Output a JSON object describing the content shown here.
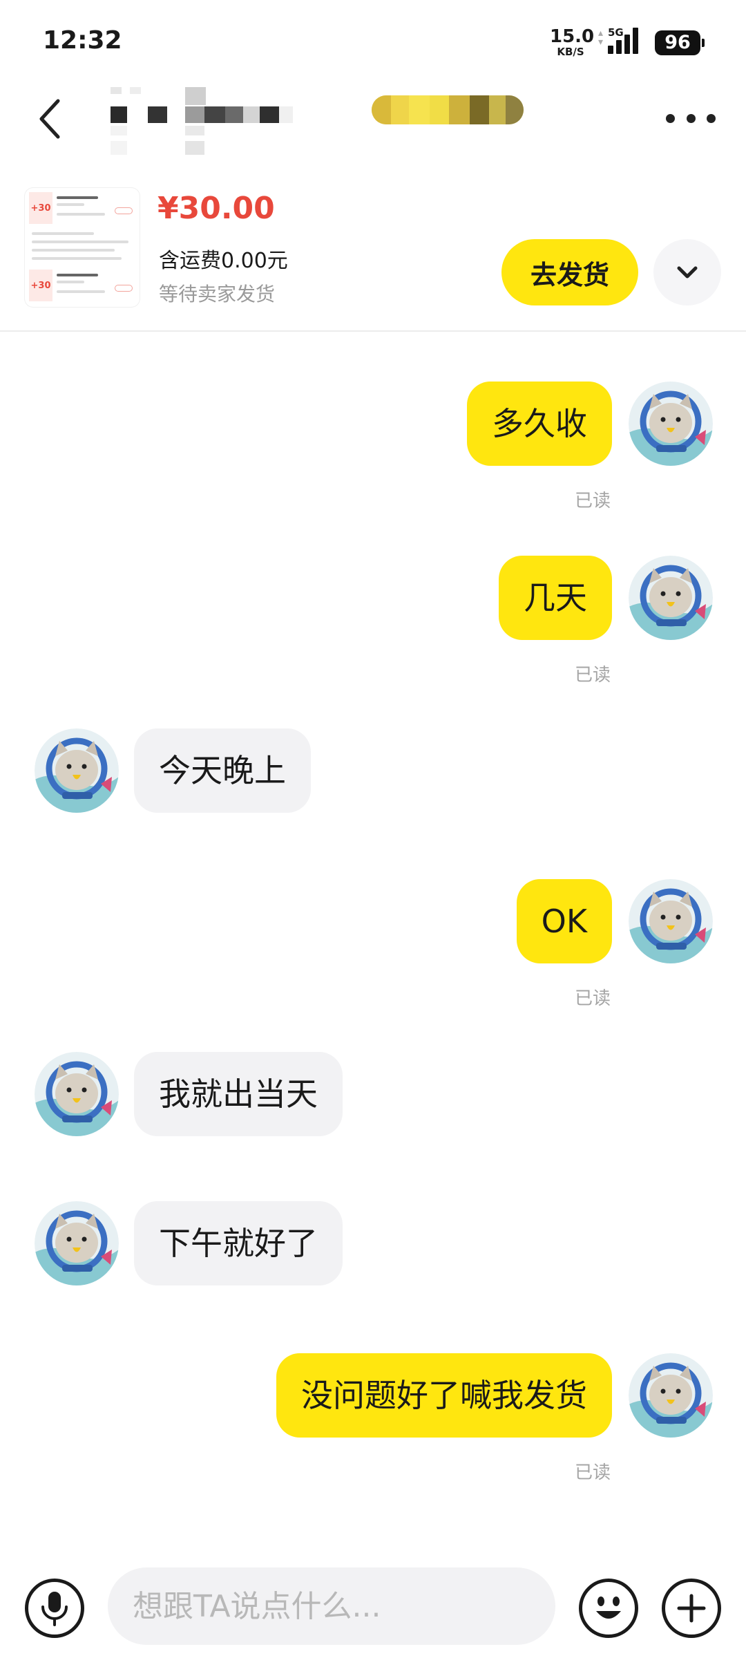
{
  "status_bar": {
    "time": "12:32",
    "net_speed": "15.0",
    "net_unit": "KB/S",
    "network_type": "5G",
    "battery": "96"
  },
  "header": {
    "back_icon": "chevron-left-icon",
    "more_icon": "more-dots-icon"
  },
  "product": {
    "price": "¥30.00",
    "shipping": "含运费0.00元",
    "status": "等待卖家发货",
    "thumbnail_price": "+30",
    "ship_button": "去发货",
    "expand_icon": "chevron-down-icon"
  },
  "messages": [
    {
      "direction": "out",
      "text": "多久收",
      "read": "已读"
    },
    {
      "direction": "out",
      "text": "几天",
      "read": "已读"
    },
    {
      "direction": "in",
      "text": "今天晚上"
    },
    {
      "direction": "out",
      "text": "OK",
      "read": "已读"
    },
    {
      "direction": "in",
      "text": "我就出当天"
    },
    {
      "direction": "in",
      "text": "下午就好了"
    },
    {
      "direction": "out",
      "text": "没问题好了喊我发货",
      "read": "已读"
    }
  ],
  "input": {
    "placeholder": "想跟TA说点什么...",
    "voice_icon": "microphone-icon",
    "emoji_icon": "emoji-icon",
    "plus_icon": "plus-icon"
  },
  "colors": {
    "accent": "#ffe60f",
    "price": "#e8483b",
    "incoming_bubble": "#f2f2f4"
  }
}
